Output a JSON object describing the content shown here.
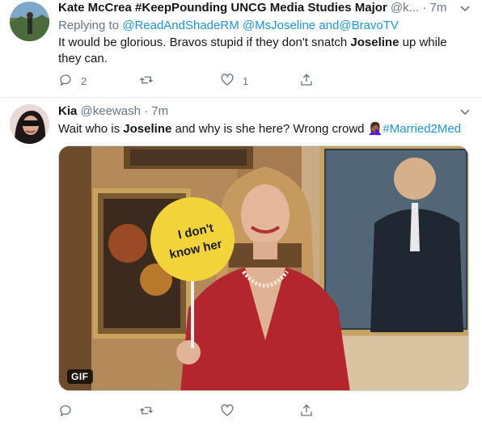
{
  "tweets": [
    {
      "display_name": "Kate McCrea #KeepPounding UNCG Media Studies Major",
      "handle": "@k...",
      "separator": "·",
      "time": "7m",
      "replying_label": "Replying to",
      "replying_to": [
        "@ReadAndShadeRM",
        "@MsJoseline",
        "@BravoTV"
      ],
      "replying_conjunction": "and",
      "text_before": "It would be glorious.  Bravos stupid if they don't snatch ",
      "text_bold": "Joseline",
      "text_after": " up while they can.",
      "reply_count": "2",
      "retweet_count": "",
      "like_count": "1"
    },
    {
      "display_name": "Kia",
      "handle": "@keewash",
      "separator": "·",
      "time": "7m",
      "text_before": "Wait who is ",
      "text_bold": "Joseline",
      "text_after": " and why is she here? Wrong crowd ",
      "emoji": "🤦🏾‍♀️",
      "hashtag": "#Married2Med",
      "media": {
        "sign_text": "I don't know her",
        "badge": "GIF"
      },
      "reply_count": "",
      "retweet_count": "",
      "like_count": ""
    }
  ],
  "colors": {
    "link": "#1b95e0",
    "secondary": "#657786",
    "primary": "#14171a",
    "divider": "#e6ecf0"
  },
  "icons": [
    "reply-icon",
    "retweet-icon",
    "like-icon",
    "share-icon",
    "caret-down-icon"
  ]
}
